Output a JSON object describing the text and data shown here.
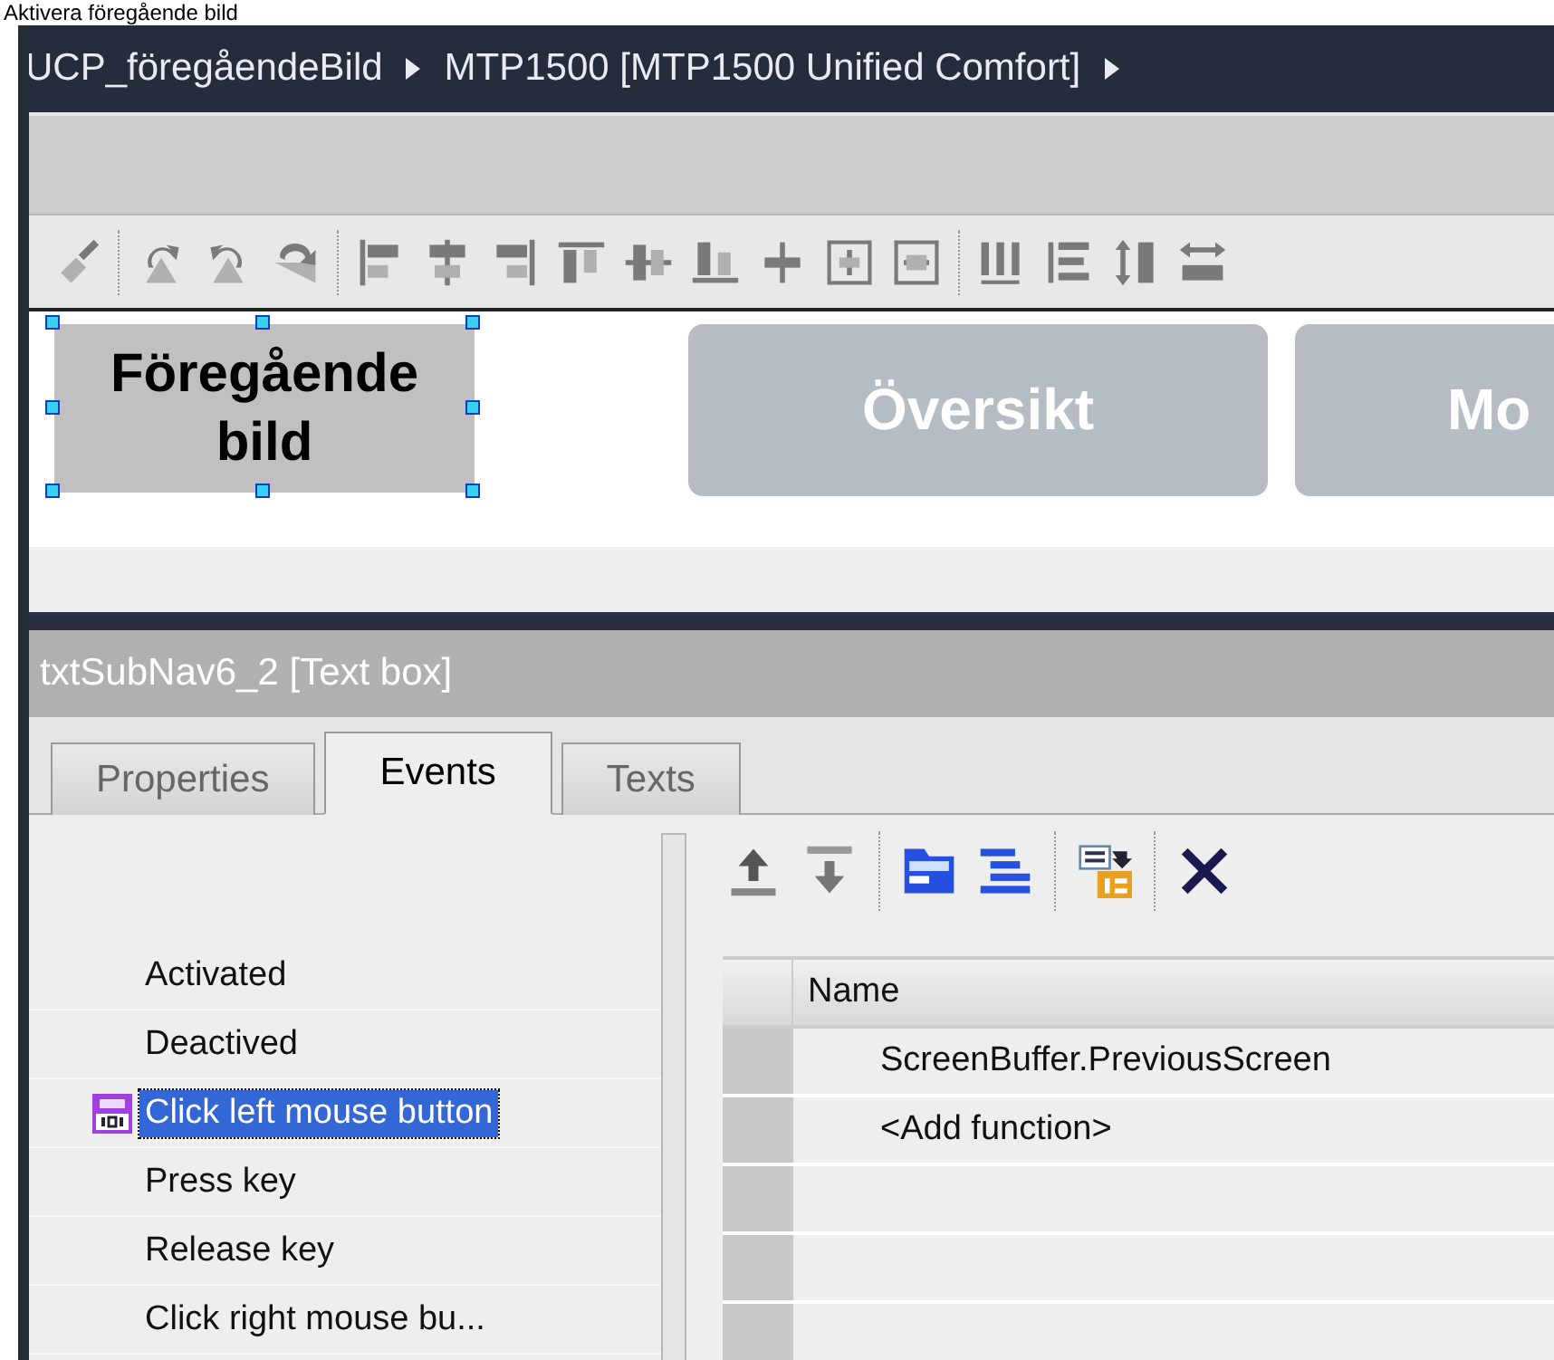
{
  "caption": "Aktivera föregående bild",
  "breadcrumb": {
    "items": [
      "UCP_föregåendeBild",
      "MTP1500 [MTP1500 Unified Comfort]"
    ]
  },
  "canvas": {
    "objects": [
      {
        "kind": "text_box",
        "text": "Föregående bild",
        "selected": true
      },
      {
        "kind": "button",
        "text": "Översikt",
        "selected": false
      },
      {
        "kind": "button",
        "text": "Mo",
        "selected": false
      }
    ]
  },
  "inspector": {
    "title": "txtSubNav6_2 [Text box]",
    "tabs": [
      {
        "label": "Properties",
        "selected": false
      },
      {
        "label": "Events",
        "selected": true
      },
      {
        "label": "Texts",
        "selected": false
      }
    ],
    "events": [
      {
        "label": "Activated",
        "selected": false,
        "has_function": false
      },
      {
        "label": "Deactived",
        "selected": false,
        "has_function": false
      },
      {
        "label": "Click left mouse button",
        "selected": true,
        "has_function": true
      },
      {
        "label": "Press key",
        "selected": false,
        "has_function": false
      },
      {
        "label": "Release key",
        "selected": false,
        "has_function": false
      },
      {
        "label": "Click right mouse bu...",
        "selected": false,
        "has_function": false
      }
    ],
    "function_list": {
      "columns": [
        "Name"
      ],
      "rows": [
        {
          "name": "ScreenBuffer.PreviousScreen"
        },
        {
          "name": "<Add function>"
        }
      ]
    }
  }
}
